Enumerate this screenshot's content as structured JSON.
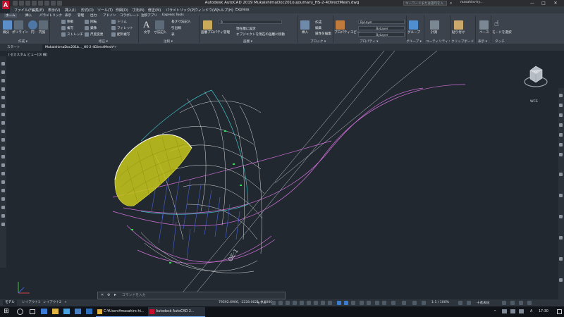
{
  "title_bar": {
    "title": "Autodesk AutoCAD 2019   MukaishimaDoc201oujoumaru_HS-2-4DirectMesh.dwg",
    "search_placeholder": "キーワードまたは語句を入力",
    "user": "masahiro-hy...",
    "min": "—",
    "max": "□",
    "close": "✕"
  },
  "menu": [
    "ファイル(F)",
    "編集(E)",
    "表示(V)",
    "挿入(I)",
    "形式(O)",
    "ツール(T)",
    "作図(D)",
    "寸法(N)",
    "修正(M)",
    "パラメトリック(P)",
    "ウィンドウ(W)",
    "ヘルプ(H)",
    "Express"
  ],
  "ribbon_tabs": [
    "ホーム",
    "挿入",
    "パラメトリック",
    "表示",
    "管理",
    "出力",
    "アドイン",
    "コラボレート",
    "注釈アプリ",
    "Express Tools"
  ],
  "ribbon": {
    "draw": {
      "title": "作成 ▾",
      "line": "線分",
      "polyline": "ポリライン",
      "circle": "円",
      "arc": "円弧"
    },
    "modify": {
      "title": "修正 ▾",
      "move": "移動",
      "rotate": "回転",
      "trim": "トリム",
      "copy": "複写",
      "mirror": "鏡像",
      "fillet": "フィレット",
      "stretch": "ストレッチ",
      "scale": "尺度変更",
      "array": "配列複写"
    },
    "annotation": {
      "title": "注釈 ▾",
      "text": "文字",
      "dimension": "寸法記入",
      "linear": "長さ寸法記入",
      "leader": "引出線",
      "table": "表"
    },
    "layers": {
      "title": "画層 ▾",
      "properties": "画層プロパティ管理",
      "layer_value": "0",
      "make_current": "現在層に設定",
      "match": "オブジェクトを現在の画層に移動"
    },
    "block": {
      "title": "ブロック ▾",
      "insert": "挿入",
      "create": "作成",
      "edit": "編集",
      "attributes": "属性を編集"
    },
    "properties": {
      "title": "プロパティ ▾",
      "match_props": "プロパティコピー",
      "bylayer_color": "ByLayer",
      "bylayer_linetype": "ByLayer",
      "bylayer_lineweight": "ByLayer"
    },
    "groups": {
      "title": "グループ ▾",
      "group": "グループ"
    },
    "utilities": {
      "title": "ユーティリティ ▾",
      "measure": "計測"
    },
    "clipboard": {
      "title": "クリップボード",
      "paste": "貼り付け"
    },
    "view": {
      "title": "表示 ▾",
      "base": "ベース"
    },
    "touch": {
      "title": "タッチ",
      "select_mode": "モードを選択"
    }
  },
  "file_tabs": {
    "start": "スタート",
    "current": "MukaishimaDoc201b..._HS-2-4DirectMesh*",
    "add": "+"
  },
  "viewport_label": "[-][カスタム ビュー][X 線]",
  "view_cube_label": "WCS",
  "drawing_annotation": "OE:1",
  "command_line": {
    "placeholder": "コマンドを入力",
    "close": "✕",
    "wrench": "⚙"
  },
  "layout_tabs": [
    "モデル",
    "レイアウト1",
    "レイアウト2",
    "+"
  ],
  "status_bar": {
    "coords": "79592.6906, -2228.0621, 0.0000",
    "mode": "モデル",
    "zoom": "1:1 / 100%",
    "units": "十進表記"
  },
  "taskbar": {
    "start": "⊞",
    "tasks": [
      "C:¥Users¥masahiro-hi...",
      "Autodesk AutoCAD 2..."
    ],
    "ime": "A",
    "time": "17:30"
  },
  "colors": {
    "accent": "#c8102e",
    "mesh_white": "#e8e8e8",
    "mesh_cyan": "#40c0c8",
    "mesh_magenta": "#d070d8",
    "mesh_blue": "#4a64e0",
    "surface_yellow": "#d8d820"
  },
  "chart_data": null
}
